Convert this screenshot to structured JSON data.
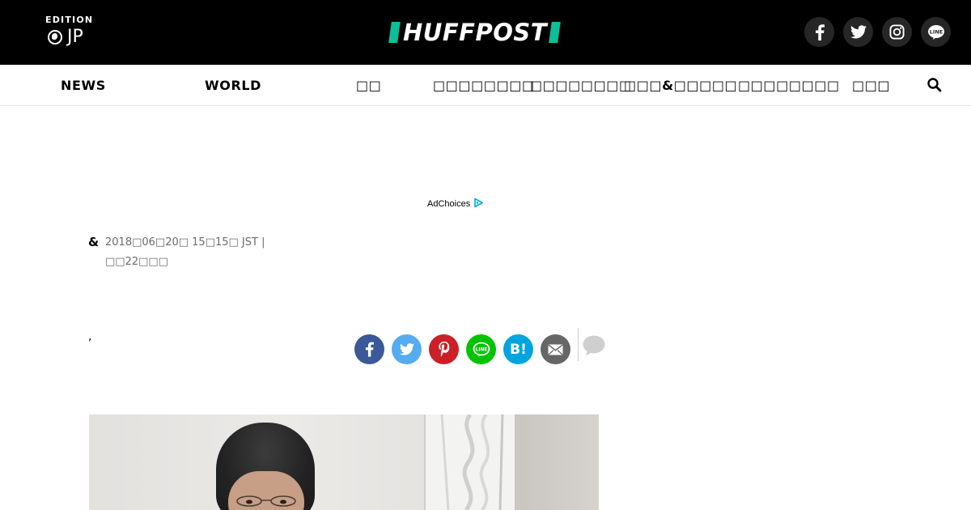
{
  "header": {
    "edition_label": "EDITION",
    "edition_code": "JP",
    "logo_text": "HUFFPOST",
    "social": [
      {
        "name": "facebook-icon"
      },
      {
        "name": "twitter-icon"
      },
      {
        "name": "instagram-icon"
      },
      {
        "name": "line-icon",
        "text": "LINE"
      }
    ]
  },
  "nav": {
    "items": [
      {
        "label": "NEWS"
      },
      {
        "label": "WORLD"
      },
      {
        "label": "□□"
      },
      {
        "label": "□□□□□□□□"
      },
      {
        "label": "□□□□□□□□"
      },
      {
        "label": "□□□&□□□□□"
      },
      {
        "label": "□□□□□□□□"
      },
      {
        "label": "□□□"
      }
    ],
    "search_icon": "search-icon"
  },
  "ad": {
    "label": "AdChoices"
  },
  "article": {
    "byline_symbol": "&",
    "published": "2018□06□20□ 15□15□ JST |",
    "updated": "□□22□□□",
    "comma": ","
  },
  "share": {
    "buttons": [
      {
        "name": "facebook-share-icon",
        "color": "#3b5998",
        "glyph": "f"
      },
      {
        "name": "twitter-share-icon",
        "color": "#55acee"
      },
      {
        "name": "pinterest-share-icon",
        "color": "#cb2027"
      },
      {
        "name": "line-share-icon",
        "color": "#00c300",
        "text": "LINE"
      },
      {
        "name": "hatena-share-icon",
        "color": "#00a4de",
        "text": "B!"
      },
      {
        "name": "email-share-icon",
        "color": "#666666"
      }
    ],
    "comment_icon": "comment-icon"
  },
  "colors": {
    "brand_green": "#0dbe98",
    "topbar_bg": "#000000"
  }
}
